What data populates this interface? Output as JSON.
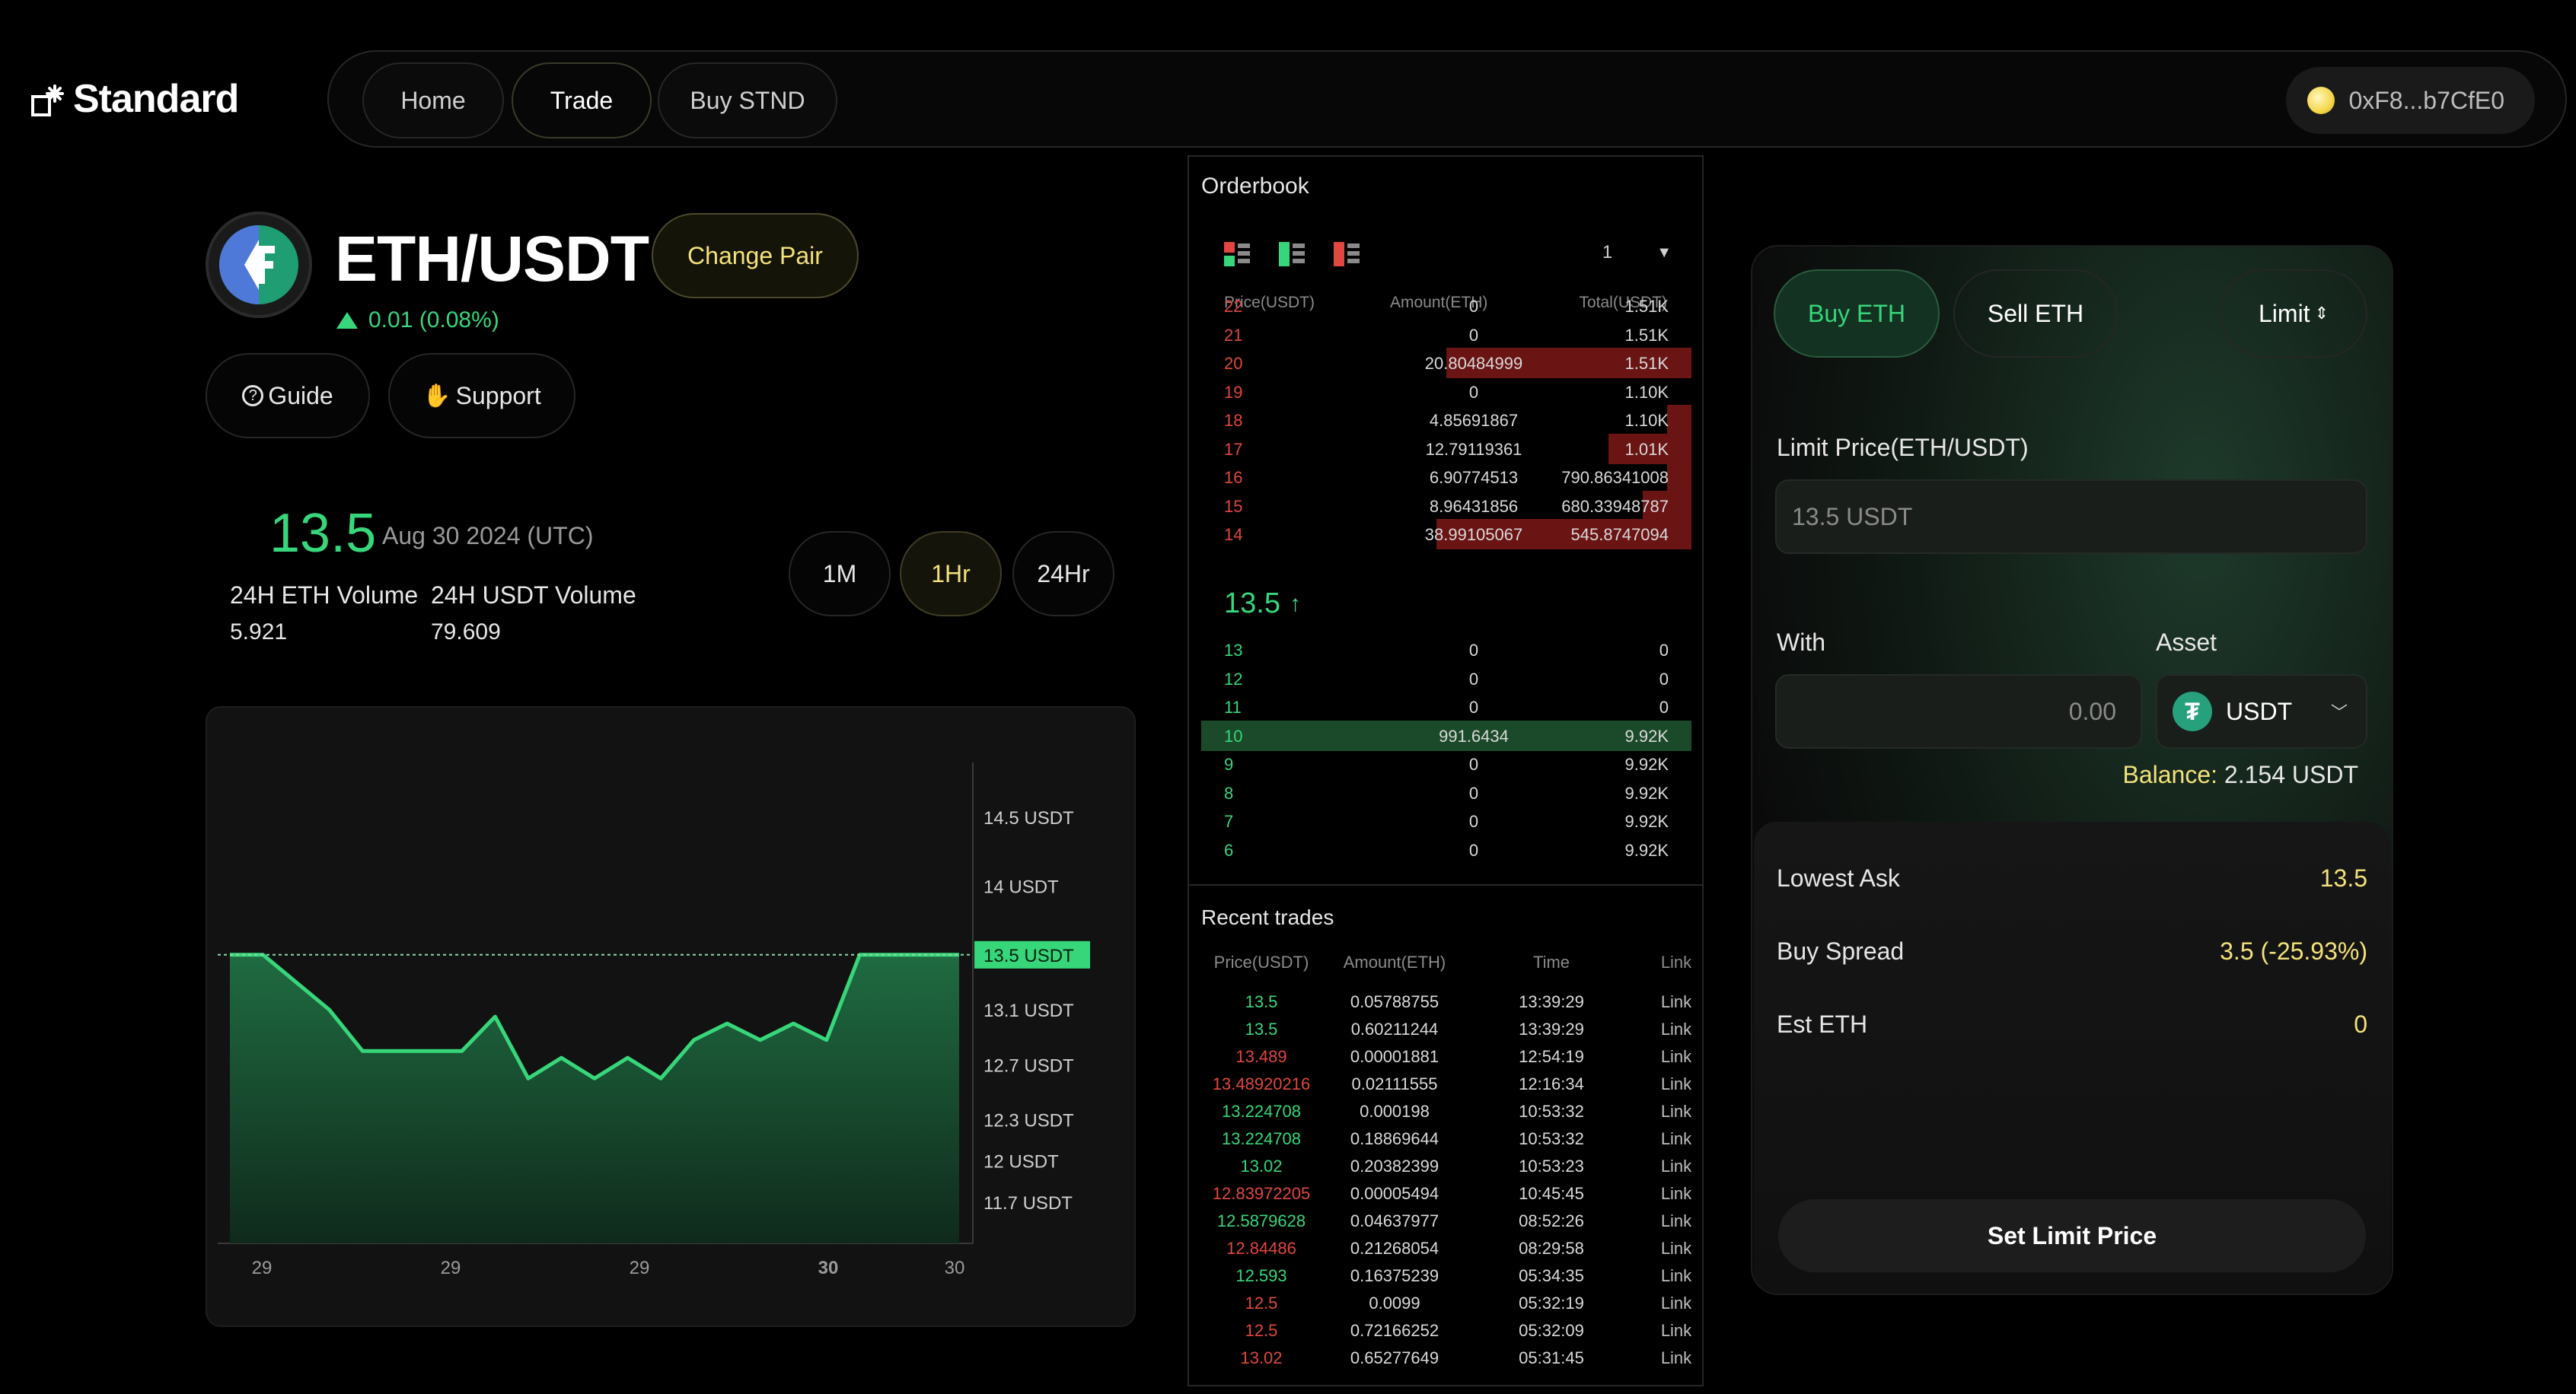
{
  "brand": {
    "name": "Standard"
  },
  "nav": {
    "tabs": [
      {
        "label": "Home"
      },
      {
        "label": "Trade"
      },
      {
        "label": "Buy STND"
      }
    ],
    "active_tab": "Trade",
    "wallet_address": "0xF8...b7CfE0"
  },
  "pair": {
    "title": "ETH/USDT",
    "change_button": "Change Pair",
    "change": "0.01 (0.08%)",
    "guide": "Guide",
    "support": "Support"
  },
  "stats": {
    "price": "13.5",
    "date": "Aug 30 2024 (UTC)",
    "eth_volume_label": "24H ETH Volume",
    "eth_volume": "5.921",
    "usdt_volume_label": "24H USDT Volume",
    "usdt_volume": "79.609"
  },
  "timeframes": [
    "1M",
    "1Hr",
    "24Hr"
  ],
  "active_timeframe": "1Hr",
  "chart_data": {
    "type": "area",
    "x": [
      "29",
      "29",
      "29",
      "29",
      "29",
      "29",
      "29",
      "29",
      "29",
      "29",
      "29",
      "29",
      "29",
      "29",
      "29",
      "29",
      "29",
      "29",
      "29",
      "30",
      "30",
      "30",
      "30"
    ],
    "x_tick_labels": [
      "29",
      "29",
      "29",
      "30",
      "30"
    ],
    "series": [
      {
        "values": [
          13.5,
          13.5,
          13.3,
          13.1,
          12.8,
          12.8,
          12.8,
          12.8,
          13.05,
          12.6,
          12.75,
          12.6,
          12.75,
          12.6,
          12.88,
          13.0,
          12.88,
          13.0,
          12.88,
          13.5,
          13.5,
          13.5,
          13.5
        ]
      }
    ],
    "y_ticks": [
      "14.5 USDT",
      "14 USDT",
      "13.1 USDT",
      "12.7 USDT",
      "12.3 USDT",
      "12 USDT",
      "11.7 USDT"
    ],
    "current_label": "13.5 USDT",
    "current_value": 13.5,
    "colors": {
      "line": "#37d67a",
      "fill": "#1f6b41"
    }
  },
  "orderbook": {
    "title": "Orderbook",
    "depth": "1",
    "headers": [
      "Price(USDT)",
      "Amount(ETH)",
      "Total(USDT)"
    ],
    "asks": [
      {
        "price": "22",
        "amount": "0",
        "total": "1.51K",
        "depth": 0
      },
      {
        "price": "21",
        "amount": "0",
        "total": "1.51K",
        "depth": 0
      },
      {
        "price": "20",
        "amount": "20.80484999",
        "total": "1.51K",
        "depth": 0.5
      },
      {
        "price": "19",
        "amount": "0",
        "total": "1.10K",
        "depth": 0
      },
      {
        "price": "18",
        "amount": "4.85691867",
        "total": "1.10K",
        "depth": 0.05
      },
      {
        "price": "17",
        "amount": "12.79119361",
        "total": "1.01K",
        "depth": 0.17
      },
      {
        "price": "16",
        "amount": "6.90774513",
        "total": "790.86341008",
        "depth": 0.05
      },
      {
        "price": "15",
        "amount": "8.96431856",
        "total": "680.33948787",
        "depth": 0.1
      },
      {
        "price": "14",
        "amount": "38.99105067",
        "total": "545.8747094",
        "depth": 0.52
      }
    ],
    "mid_price": "13.5",
    "bids": [
      {
        "price": "13",
        "amount": "0",
        "total": "0",
        "depth": 0
      },
      {
        "price": "12",
        "amount": "0",
        "total": "0",
        "depth": 0
      },
      {
        "price": "11",
        "amount": "0",
        "total": "0",
        "depth": 0
      },
      {
        "price": "10",
        "amount": "991.6434",
        "total": "9.92K",
        "depth": 1
      },
      {
        "price": "9",
        "amount": "0",
        "total": "9.92K",
        "depth": 0
      },
      {
        "price": "8",
        "amount": "0",
        "total": "9.92K",
        "depth": 0
      },
      {
        "price": "7",
        "amount": "0",
        "total": "9.92K",
        "depth": 0
      },
      {
        "price": "6",
        "amount": "0",
        "total": "9.92K",
        "depth": 0
      }
    ]
  },
  "recent_trades": {
    "title": "Recent trades",
    "headers": [
      "Price(USDT)",
      "Amount(ETH)",
      "Time",
      "Link"
    ],
    "rows": [
      {
        "price": "13.5",
        "amount": "0.05788755",
        "time": "13:39:29",
        "link": "Link",
        "side": "buy"
      },
      {
        "price": "13.5",
        "amount": "0.60211244",
        "time": "13:39:29",
        "link": "Link",
        "side": "buy"
      },
      {
        "price": "13.489",
        "amount": "0.00001881",
        "time": "12:54:19",
        "link": "Link",
        "side": "sell"
      },
      {
        "price": "13.48920216",
        "amount": "0.02111555",
        "time": "12:16:34",
        "link": "Link",
        "side": "sell"
      },
      {
        "price": "13.224708",
        "amount": "0.000198",
        "time": "10:53:32",
        "link": "Link",
        "side": "buy"
      },
      {
        "price": "13.224708",
        "amount": "0.18869644",
        "time": "10:53:32",
        "link": "Link",
        "side": "buy"
      },
      {
        "price": "13.02",
        "amount": "0.20382399",
        "time": "10:53:23",
        "link": "Link",
        "side": "buy"
      },
      {
        "price": "12.83972205",
        "amount": "0.00005494",
        "time": "10:45:45",
        "link": "Link",
        "side": "sell"
      },
      {
        "price": "12.5879628",
        "amount": "0.04637977",
        "time": "08:52:26",
        "link": "Link",
        "side": "buy"
      },
      {
        "price": "12.84486",
        "amount": "0.21268054",
        "time": "08:29:58",
        "link": "Link",
        "side": "sell"
      },
      {
        "price": "12.593",
        "amount": "0.16375239",
        "time": "05:34:35",
        "link": "Link",
        "side": "buy"
      },
      {
        "price": "12.5",
        "amount": "0.0099",
        "time": "05:32:19",
        "link": "Link",
        "side": "sell"
      },
      {
        "price": "12.5",
        "amount": "0.72166252",
        "time": "05:32:09",
        "link": "Link",
        "side": "sell"
      },
      {
        "price": "13.02",
        "amount": "0.65277649",
        "time": "05:31:45",
        "link": "Link",
        "side": "sell"
      }
    ]
  },
  "trade_panel": {
    "buy_label": "Buy ETH",
    "sell_label": "Sell ETH",
    "order_type": "Limit",
    "limit_price_label": "Limit Price(ETH/USDT)",
    "limit_price_value": "13.5 USDT",
    "with_label": "With",
    "asset_label": "Asset",
    "with_placeholder": "0.00",
    "asset": "USDT",
    "balance_label": "Balance:",
    "balance_value": "2.154 USDT",
    "lowest_ask_label": "Lowest Ask",
    "lowest_ask": "13.5",
    "buy_spread_label": "Buy Spread",
    "buy_spread": "3.5 (-25.93%)",
    "est_label": "Est ETH",
    "est_value": "0",
    "submit": "Set Limit Price"
  },
  "colors": {
    "green": "#37d67a",
    "red": "#e0473f",
    "yellow": "#f3e27a"
  }
}
